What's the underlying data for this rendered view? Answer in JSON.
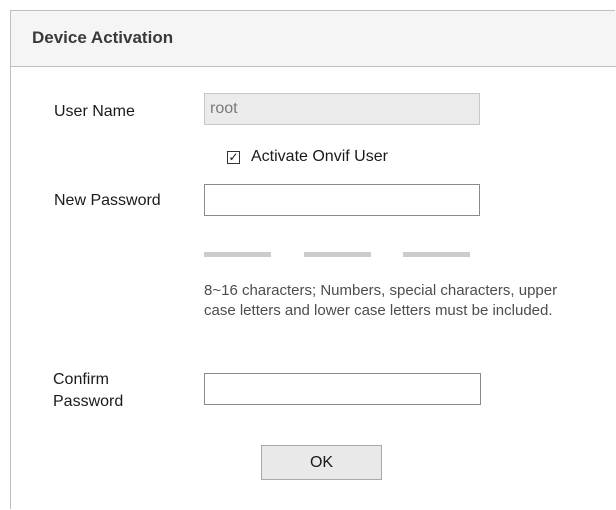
{
  "dialog": {
    "title": "Device Activation"
  },
  "form": {
    "username_label": "User Name",
    "username_value": "root",
    "onvif_checkbox_label": "Activate Onvif User",
    "onvif_checked": true,
    "new_password_label": "New Password",
    "new_password_value": "",
    "hint_text": "8~16 characters; Numbers, special characters, upper case letters and lower case letters must be included.",
    "confirm_label_line1": "Confirm",
    "confirm_label_line2": "Password",
    "confirm_password_value": "",
    "ok_label": "OK"
  },
  "colors": {
    "strength_bar_inactive": "#cccccc",
    "disabled_field_bg": "#ebebeb"
  }
}
